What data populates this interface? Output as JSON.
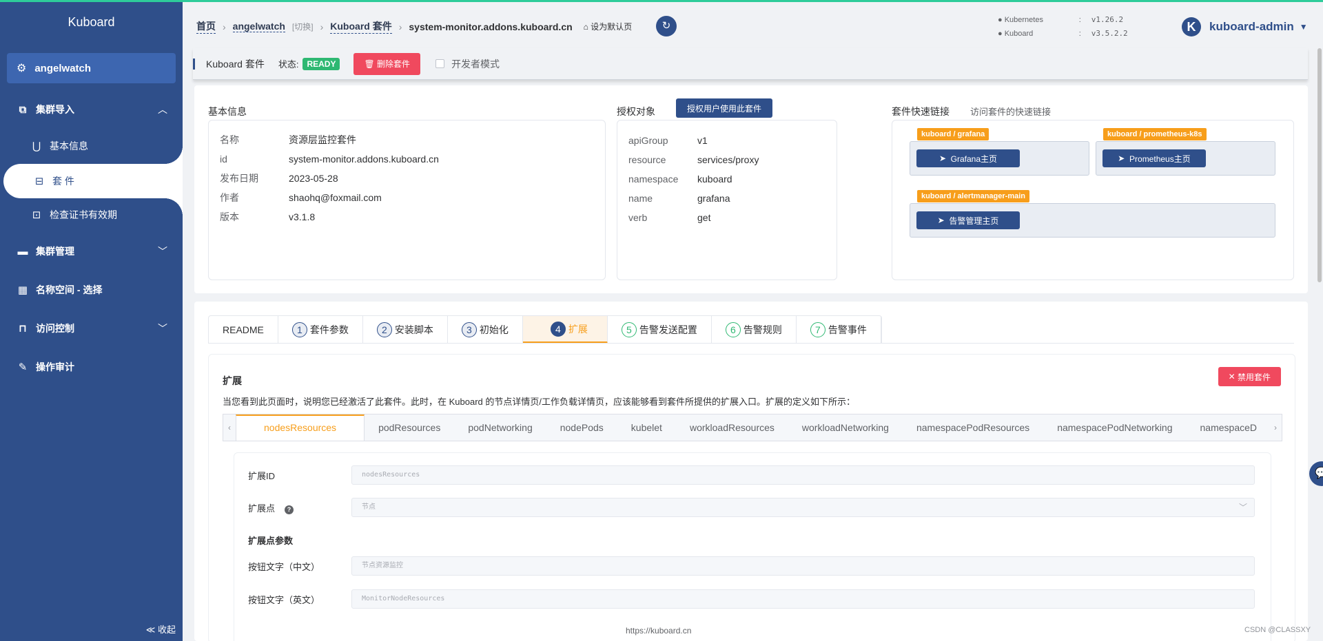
{
  "sidebar": {
    "brand": "Kuboard",
    "cluster": "angelwatch",
    "collapse": "≪ 收起",
    "items": [
      {
        "label": "集群导入"
      },
      {
        "label": "基本信息"
      },
      {
        "label": "套 件"
      },
      {
        "label": "检查证书有效期"
      },
      {
        "label": "集群管理"
      },
      {
        "label": "名称空间 - 选择"
      },
      {
        "label": "访问控制"
      },
      {
        "label": "操作审计"
      }
    ]
  },
  "header": {
    "crumb_home": "首页",
    "crumb_cluster": "angelwatch",
    "crumb_switch": "[切换]",
    "crumb_suite": "Kuboard 套件",
    "crumb_current": "system-monitor.addons.kuboard.cn",
    "set_default": "设为默认页",
    "versions": [
      {
        "name": "Kubernetes",
        "value": "v1.26.2"
      },
      {
        "name": "Kuboard",
        "value": "v3.5.2.2"
      }
    ],
    "avatar_letter": "K",
    "user": "kuboard-admin"
  },
  "toolbar": {
    "title": "Kuboard 套件",
    "status_label": "状态:",
    "status": "READY",
    "delete": "删除套件",
    "dev_mode": "开发者模式"
  },
  "basic": {
    "title": "基本信息",
    "rows": [
      {
        "k": "名称",
        "v": "资源层监控套件"
      },
      {
        "k": "id",
        "v": "system-monitor.addons.kuboard.cn"
      },
      {
        "k": "发布日期",
        "v": "2023-05-28"
      },
      {
        "k": "作者",
        "v": "shaohq@foxmail.com"
      },
      {
        "k": "版本",
        "v": "v3.1.8"
      }
    ]
  },
  "auth": {
    "title": "授权对象",
    "button": "授权用户使用此套件",
    "rows": [
      {
        "k": "apiGroup",
        "v": "v1"
      },
      {
        "k": "resource",
        "v": "services/proxy"
      },
      {
        "k": "namespace",
        "v": "kuboard"
      },
      {
        "k": "name",
        "v": "grafana"
      },
      {
        "k": "verb",
        "v": "get"
      }
    ]
  },
  "links": {
    "title": "套件快速链接",
    "subtitle": "访问套件的快速链接",
    "items": [
      {
        "tag": "kuboard / grafana",
        "button": "Grafana主页"
      },
      {
        "tag": "kuboard / prometheus-k8s",
        "button": "Prometheus主页"
      },
      {
        "tag": "kuboard / alertmanager-main",
        "button": "告警管理主页"
      }
    ]
  },
  "tabs": [
    {
      "num": "",
      "label": "README"
    },
    {
      "num": "1",
      "label": "套件参数"
    },
    {
      "num": "2",
      "label": "安装脚本"
    },
    {
      "num": "3",
      "label": "初始化"
    },
    {
      "num": "4",
      "label": "扩展"
    },
    {
      "num": "5",
      "label": "告警发送配置"
    },
    {
      "num": "6",
      "label": "告警规则"
    },
    {
      "num": "7",
      "label": "告警事件"
    }
  ],
  "extension": {
    "title": "扩展",
    "disable": "禁用套件",
    "desc": "当您看到此页面时，说明您已经激活了此套件。此时，在 Kuboard 的节点详情页/工作负载详情页，应该能够看到套件所提供的扩展入口。扩展的定义如下所示：",
    "subtabs": [
      "nodesResources",
      "podResources",
      "podNetworking",
      "nodePods",
      "kubelet",
      "workloadResources",
      "workloadNetworking",
      "namespacePodResources",
      "namespacePodNetworking",
      "namespaceD"
    ],
    "form": {
      "id_label": "扩展ID",
      "id_value": "nodesResources",
      "point_label": "扩展点",
      "point_value": "节点",
      "params_label": "扩展点参数",
      "btn_cn_label": "按钮文字（中文）",
      "btn_cn_value": "节点资源监控",
      "btn_en_label": "按钮文字（英文）",
      "btn_en_value": "MonitorNodeResources"
    }
  },
  "footer": {
    "url": "https://kuboard.cn",
    "watermark": "CSDN @CLASSXY"
  },
  "colors": {
    "sidebar": "#2f4f8a",
    "accent": "#f79e1b",
    "danger": "#f0495e",
    "success": "#2eb872"
  }
}
